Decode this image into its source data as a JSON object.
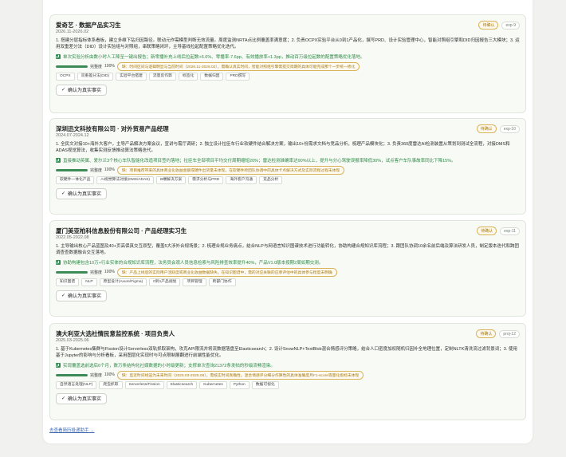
{
  "cards": [
    {
      "title": "爱奇艺 · 数据产品实习生",
      "status": "待确认",
      "id": "exp-9",
      "date": "2026.11-2026.02",
      "desc": "1. 搭建分层指标体系看板，建立多维下钻归因路径。联动元作需模型判断无效流量。周度监测NRTA点比例覆盖率满意度；2. 负责OCPX实验平台从0到1产品化，撰写PRD、设计实验管理中心，智能对照组引擎和DID归因报告三大模块；3. 运用双重差分法（DID）设计实验组与对照组，串联策略闭环，主导基线拉起配置策略优化迭代。",
      "impact": "单次实验分析由数小时人工降至一键出报告；新零播补充上线后拉起数+6.6%、零播率-7.6pp、有效播放率+1.3pp，推动百万级拉起数的配置策略优化落地。",
      "progress_label": "完整度",
      "progress": "100%",
      "progress_value": 1.0,
      "note": "缺：时间区间与逻辑明显与当前时间（2026.11-2026.02），需确认真实时间，智能对照组引擎需提交简期的具体可能完成那个一步统一修化",
      "skills": [
        "OCPX",
        "双重差分法(DID)",
        "实验平台搭建",
        "流量反作弊",
        "标签化",
        "数据归因",
        "PRD撰写"
      ],
      "confirm": "确认为真实事实"
    },
    {
      "title": "深圳迅文科技有限公司 · 对外贸易产品经理",
      "status": "待确认",
      "id": "exp-10",
      "date": "2024.07-2024.12",
      "desc": "1. 全民文对接10+海外大客户，主导产品解决方案会议，宣讲与需厅调研；2. 独立设计拉臣车行业软硬件结合解决方案，输出10+份需求文档与竞品分析，梳理产品模块化；3. 负责360度雷达AI检测装置从策划到测试全流程，对接DMS和ADAS视觉算法，收集实测反馈推动算法策略迭代。",
      "impact": "直接推动英属、爱尔兰3个核心车队智能化改造项目签约落地；拉臣车全部项目平均交付周期缩短20%；雷达检测准确率达90%以上，提升与分心驾驶误报率降低30%，试点客户车队事故率同比下降15%。",
      "progress_label": "完整度",
      "progress": "100%",
      "progress_value": 1.0,
      "note": "缺：项目推荐带来的具体商业化收益金额或硬件出货量未体现。在软硬件跨团队协调中的具体卡点解决方式及实际流程过程未体现",
      "skills": [
        "软硬件一体化产品",
        "AI视觉算法对接(DMS/ADAS)",
        "B端解决方案",
        "需求分析与PRD",
        "海外客户沟通",
        "竞品分析"
      ],
      "confirm": "确认为真实事实"
    },
    {
      "title": "厦门美亚柏科信息股份有限公司 · 产品经理实习生",
      "status": "待确认",
      "id": "exp-11",
      "date": "2022.05-2022.08",
      "desc": "1. 主导输出核心产品蓝图及40+页高保真交互原型，覆盖5大涉外合规场景；2. 梳理合规业务痛点，结合NLP与网语言知识图谱技术进行功能转化，协助构建合规知识库流程；3. 跟团队协调10余名前后端及算法研发人员，制定版本迭代和跨团调查查数据融合交互落地。",
      "impact": "协助构建包含10万+行业实体的合规知识库流程，法务员会观人员信息检索与风险排查效率提升40%，产品V1.0版本按期2周如期交测。",
      "progress_label": "完整度",
      "progress": "100%",
      "progress_value": 1.0,
      "note": "缺：产品上线后的实际用户活跃度或商业化收益数据缺失。在知识图谱中，需的对应关联的应承评估中的具体参与程度未明确",
      "skills": [
        "知识图谱",
        "NLP",
        "原型设计(Axure/Figma)",
        "0到1产品规划",
        "项目管理",
        "跨部门协作"
      ],
      "confirm": "确认为真实事实"
    },
    {
      "title": "澳大利亚大选社情民意监控系统 · 项目负责人",
      "status": "待确认",
      "id": "proj-12",
      "date": "2025.03-2025.06",
      "desc": "1. 基于Kubernetes集群与Fission设计Serverless双轨抓取架构，攻克API限流并将流数据落盘至Elasticsearch；2. 设计SnowNLP+TextBlob混合情感评分策略，结合人口密度加权随机归因补全地理位置，定制NLTK清洗流过滤背景词；3. 使用基于Jupyter的影响与分析看板，采用图层化实现时与可点限制展翻进行前端性能优化。",
      "impact": "实现覆盖选前选后6个月，数万条结构化社媒数据的小时级更新；支撑单次查询21372条发帖的秒级流畅渲染。",
      "progress_label": "完整度",
      "progress": "100%",
      "progress_value": 1.0,
      "note": "缺：监近时间线迫为未来时间（2025.03-2025.06），需核实时间真确性。混合情感评分细分作算性的具体准确度月F1-score等量化指标未体现",
      "skills": [
        "自然语言处理(NLP)",
        "爬虫抓取",
        "Serverless/Fission",
        "Elasticsearch",
        "Kubernetes",
        "Python",
        "数据可视化"
      ],
      "confirm": "确认为真实事实"
    }
  ],
  "footer_link": "去查看简历投递助手 →",
  "colors": {
    "accent_green": "#3c8a55",
    "pending_orange": "#d9b35a",
    "link_blue": "#3a66b0"
  }
}
